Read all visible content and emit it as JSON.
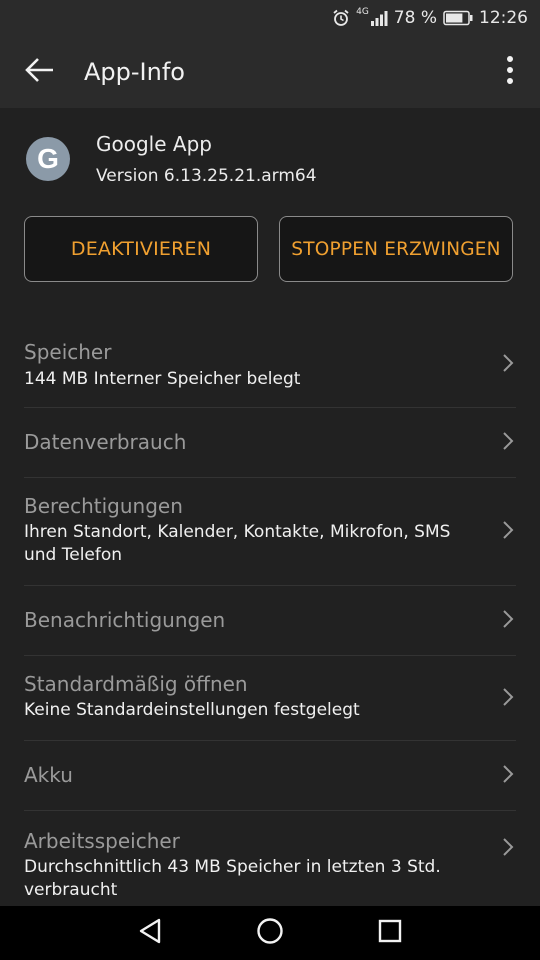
{
  "status_bar": {
    "network": "4G",
    "battery_percent": "78 %",
    "battery_level": 0.78,
    "time": "12:26",
    "icons": [
      "alarm-icon",
      "signal-icon",
      "battery-icon"
    ]
  },
  "app_bar": {
    "title": "App-Info",
    "back_icon": "arrow-left-icon",
    "overflow_icon": "more-vert-icon"
  },
  "app": {
    "icon_letter": "G",
    "name": "Google App",
    "version": "Version 6.13.25.21.arm64"
  },
  "actions": {
    "disable_label": "DEAKTIVIEREN",
    "force_stop_label": "STOPPEN ERZWINGEN"
  },
  "list": {
    "items": [
      {
        "title": "Speicher",
        "subtitle": "144 MB Interner Speicher belegt"
      },
      {
        "title": "Datenverbrauch",
        "subtitle": ""
      },
      {
        "title": "Berechtigungen",
        "subtitle": "Ihren Standort, Kalender, Kontakte, Mikrofon, SMS und Telefon"
      },
      {
        "title": "Benachrichtigungen",
        "subtitle": ""
      },
      {
        "title": "Standardmäßig öffnen",
        "subtitle": "Keine Standardeinstellungen festgelegt"
      },
      {
        "title": "Akku",
        "subtitle": ""
      },
      {
        "title": "Arbeitsspeicher",
        "subtitle": "Durchschnittlich 43 MB Speicher in letzten 3 Std. verbraucht"
      }
    ]
  },
  "colors": {
    "accent": "#f0a030",
    "background": "#212121",
    "bar": "#2b2b2b"
  },
  "nav_bar": {
    "icons": [
      "back-triangle-icon",
      "home-circle-icon",
      "recents-square-icon"
    ]
  }
}
